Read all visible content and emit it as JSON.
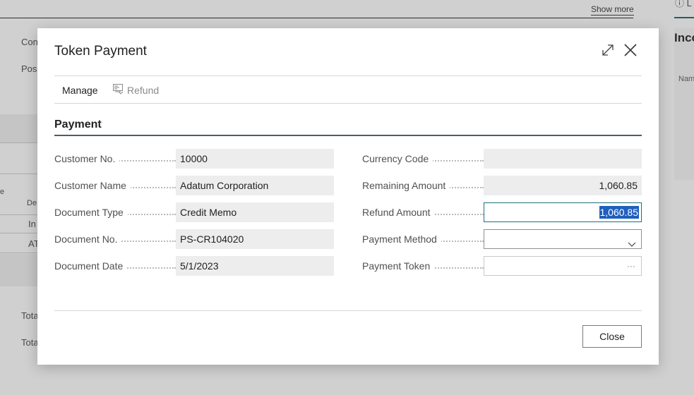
{
  "background": {
    "show_more": "Show more",
    "right_panel_title": "Inco",
    "right_panel_info": "ⓘ L",
    "right_panel_name": "Nam",
    "left_labels": {
      "con": "Con",
      "pos": "Pos",
      "e": "e",
      "de": "De",
      "in": "In",
      "at": "AT",
      "tota1": "Tota",
      "tota2": "Tota"
    }
  },
  "dialog": {
    "title": "Token Payment",
    "actions": {
      "manage": "Manage",
      "refund": "Refund"
    },
    "section_title": "Payment",
    "left_fields": [
      {
        "label": "Customer No.",
        "value": "10000"
      },
      {
        "label": "Customer Name",
        "value": "Adatum Corporation"
      },
      {
        "label": "Document Type",
        "value": "Credit Memo"
      },
      {
        "label": "Document No.",
        "value": "PS-CR104020"
      },
      {
        "label": "Document Date",
        "value": "5/1/2023"
      }
    ],
    "right_fields": {
      "currency_code": {
        "label": "Currency Code",
        "value": ""
      },
      "remaining_amount": {
        "label": "Remaining Amount",
        "value": "1,060.85"
      },
      "refund_amount": {
        "label": "Refund Amount",
        "value": "1,060.85"
      },
      "payment_method": {
        "label": "Payment Method",
        "value": ""
      },
      "payment_token": {
        "label": "Payment Token",
        "value": "",
        "lookup": "···"
      }
    },
    "close_button": "Close"
  },
  "colors": {
    "accent": "#1e6f7b",
    "selection": "#1f5fbf",
    "field_bg": "#ededed"
  }
}
